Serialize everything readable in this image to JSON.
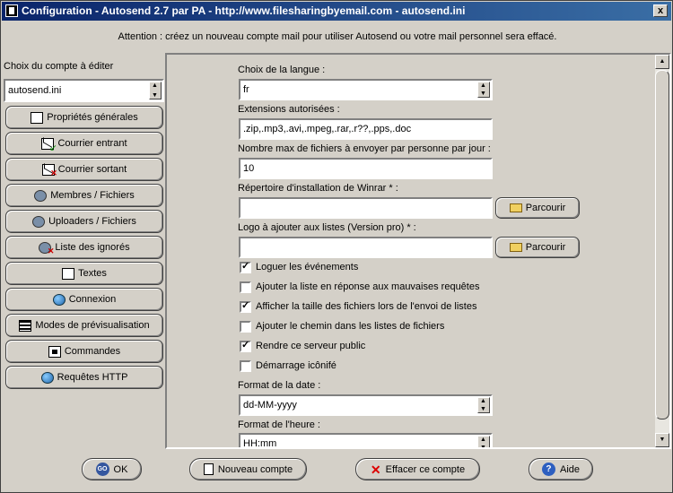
{
  "window": {
    "title": "Configuration - Autosend 2.7 par PA - http://www.filesharingbyemail.com - autosend.ini",
    "close": "x"
  },
  "notice": "Attention : créez un nouveau compte mail pour utiliser Autosend ou votre mail personnel sera effacé.",
  "left": {
    "account_label": "Choix du compte à éditer",
    "account_value": "autosend.ini",
    "nav": [
      {
        "label": "Propriétés générales",
        "icon": "properties-icon"
      },
      {
        "label": "Courrier entrant",
        "icon": "incoming-mail-icon"
      },
      {
        "label": "Courrier sortant",
        "icon": "outgoing-mail-icon"
      },
      {
        "label": "Membres / Fichiers",
        "icon": "members-gear-icon"
      },
      {
        "label": "Uploaders / Fichiers",
        "icon": "uploaders-gear-icon"
      },
      {
        "label": "Liste des ignorés",
        "icon": "ignored-list-icon"
      },
      {
        "label": "Textes",
        "icon": "texts-icon"
      },
      {
        "label": "Connexion",
        "icon": "connection-globe-icon"
      },
      {
        "label": "Modes de prévisualisation",
        "icon": "preview-modes-icon"
      },
      {
        "label": "Commandes",
        "icon": "commands-icon"
      },
      {
        "label": "Requêtes HTTP",
        "icon": "http-globe-icon"
      }
    ]
  },
  "form": {
    "language_label": "Choix de la langue :",
    "language_value": "fr",
    "extensions_label": "Extensions autorisées :",
    "extensions_value": ".zip,.mp3,.avi,.mpeg,.rar,.r??,.pps,.doc",
    "maxfiles_label": "Nombre max de fichiers à envoyer par personne par jour :",
    "maxfiles_value": "10",
    "winrar_label": "Répertoire d'installation de Winrar * :",
    "winrar_value": "",
    "browse_label": "Parcourir",
    "logo_label": "Logo à ajouter aux listes (Version pro) * :",
    "logo_value": "",
    "checkboxes": [
      {
        "label": "Loguer les événements",
        "checked": true
      },
      {
        "label": "Ajouter la liste en réponse aux mauvaises requêtes",
        "checked": false
      },
      {
        "label": "Afficher la taille des fichiers lors de l'envoi de listes",
        "checked": true
      },
      {
        "label": "Ajouter le chemin dans les listes de fichiers",
        "checked": false
      },
      {
        "label": "Rendre ce serveur public",
        "checked": true
      },
      {
        "label": "Démarrage icônifé",
        "checked": false
      }
    ],
    "date_format_label": "Format de la date :",
    "date_format_value": "dd-MM-yyyy",
    "time_format_label": "Format de l'heure :",
    "time_format_value": "HH:mm"
  },
  "buttons": {
    "ok": "OK",
    "ok_icon_text": "GO",
    "new_account": "Nouveau compte",
    "delete_account": "Effacer ce compte",
    "help": "Aide",
    "help_icon_text": "?"
  }
}
